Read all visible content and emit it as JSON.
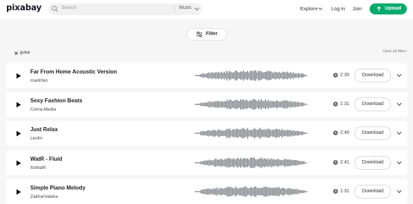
{
  "header": {
    "logo": "pixabay",
    "search_placeholder": "Search",
    "search_type": "Music",
    "explore": "Explore",
    "login": "Log in",
    "join": "Join",
    "upload": "Upload"
  },
  "filter_label": "Filter",
  "active_tag": "guitar",
  "clear_all": "Clear all filters",
  "colors": {
    "accent": "#00ab6b",
    "waveform": "#7a7f86"
  },
  "tracks": [
    {
      "title": "Far From Home Acoustic Version",
      "artist": "madirfan",
      "duration": "2:35",
      "download": "Download"
    },
    {
      "title": "Sexy Fashion Beats",
      "artist": "Coma-Media",
      "duration": "1:31",
      "download": "Download"
    },
    {
      "title": "Just Relax",
      "artist": "Lesfm",
      "duration": "2:40",
      "download": "Download"
    },
    {
      "title": "WatR - Fluid",
      "artist": "ItsWatR",
      "duration": "2:41",
      "download": "Download"
    },
    {
      "title": "Simple Piano Melody",
      "artist": "ZakharValaha",
      "duration": "1:31",
      "download": "Download"
    }
  ]
}
